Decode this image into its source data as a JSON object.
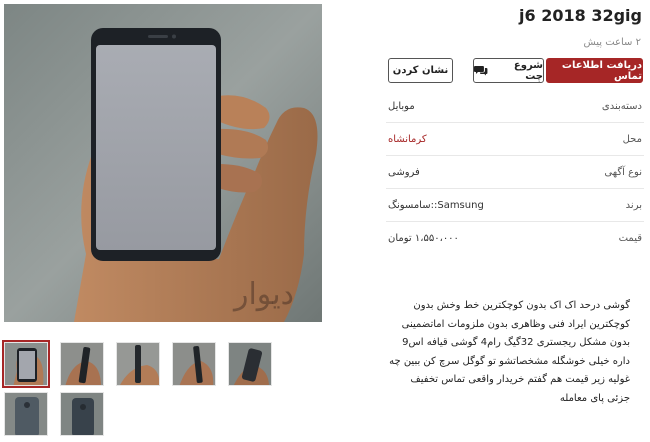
{
  "listing": {
    "title": "j6 2018 32gig",
    "posted_time": "۲ ساعت پیش",
    "buttons": {
      "contact_info": "دریافت اطلاعات تماس",
      "start_chat": "شروع چت",
      "bookmark": "نشان کردن"
    },
    "chat_icon": "chat-bubbles-icon",
    "details": [
      {
        "label": "دسته‌بندی",
        "value": "موبایل",
        "link": false
      },
      {
        "label": "محل",
        "value": "کرمانشاه",
        "link": true
      },
      {
        "label": "نوع آگهی",
        "value": "فروشی",
        "link": false
      },
      {
        "label": "برند",
        "value": "Samsung::سامسونگ",
        "link": false
      },
      {
        "label": "قیمت",
        "value": "۱،۵۵۰،۰۰۰ تومان",
        "link": false
      }
    ],
    "description": "گوشی درحد اک اک بدون کوچکترین خط وخش بدون کوچکترین ایراد فنی وظاهری بدون ملزومات اماتضمینی بدون مشکل ریجستری 32گیگ رام4 گوشی قیافه اس9 داره خیلی خوشگله مشخصاتشو تو گوگل سرچ کن ببین چه غولیه زیر قیمت هم گفتم خریدار واقعی تماس تخفیف جزئی پای معامله",
    "watermark": "دیوار"
  },
  "colors": {
    "accent": "#a62626",
    "text": "#333333",
    "muted": "#888888",
    "divider": "#e8e8e8"
  },
  "thumbnails": {
    "count": 7,
    "selected_index": 0
  }
}
